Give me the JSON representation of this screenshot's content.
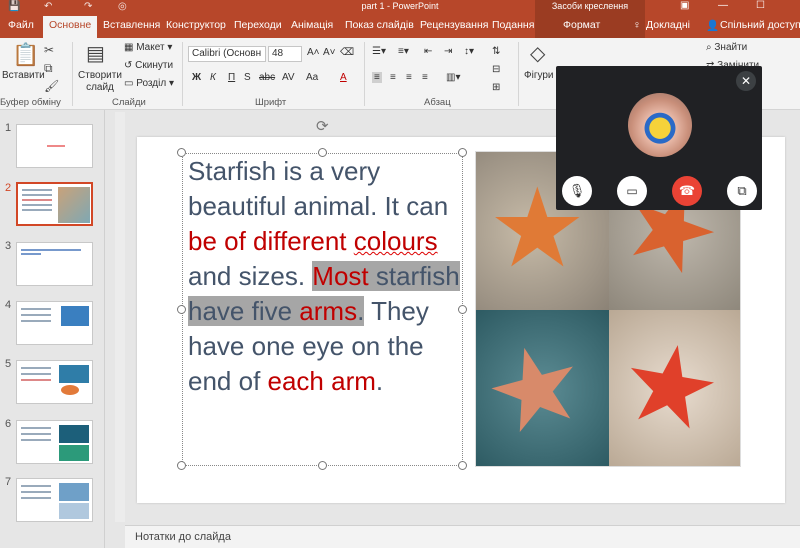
{
  "app": {
    "title": "part 1 - PowerPoint",
    "context_tool": "Засоби креслення"
  },
  "tabs": {
    "file": "Файл",
    "home": "Основне",
    "insert": "Вставлення",
    "design": "Конструктор",
    "transitions": "Переходи",
    "animations": "Анімація",
    "slideshow": "Показ слайдів",
    "review": "Рецензування",
    "view": "Подання",
    "format": "Формат",
    "tellme": "Докладні",
    "share": "Спільний доступ"
  },
  "ribbon": {
    "paste": "Вставити",
    "clipboard_group": "Буфер обміну",
    "new_slide": "Створити слайд",
    "layout": "Макет",
    "reset": "Скинути",
    "section": "Розділ",
    "slides_group": "Слайди",
    "font_name": "Calibri (Основн",
    "font_size": "48",
    "font_group": "Шрифт",
    "bold": "Ж",
    "italic": "К",
    "underline": "П",
    "shadow": "S",
    "strike": "abc",
    "spacing": "AV",
    "case": "Aa",
    "font_color": "A",
    "paragraph_group": "Абзац",
    "shapes": "Фігури",
    "find": "Знайти",
    "replace": "Замінити"
  },
  "slides_pane": {
    "numbers": [
      "1",
      "2",
      "3",
      "4",
      "5",
      "6",
      "7"
    ]
  },
  "slide": {
    "text_segments": [
      {
        "t": "Starfish is a very beautiful animal. It can ",
        "c": "n"
      },
      {
        "t": "be of different",
        "c": "r"
      },
      {
        "t": " ",
        "c": "n"
      },
      {
        "t": "colours",
        "c": "rs"
      },
      {
        "t": " and sizes. ",
        "c": "n"
      },
      {
        "t": "Most",
        "c": "rh"
      },
      {
        "t": " starfish have five ",
        "c": "h"
      },
      {
        "t": "arms",
        "c": "rh"
      },
      {
        "t": ".",
        "c": "h"
      },
      {
        "t": " They have one eye on the end of ",
        "c": "n"
      },
      {
        "t": "each arm",
        "c": "r"
      },
      {
        "t": ".",
        "c": "n"
      }
    ]
  },
  "notes": {
    "label": "Нотатки до слайда"
  },
  "call": {
    "close": "✕"
  },
  "colors": {
    "accent": "#b7472a",
    "text": "#44546a",
    "red": "#c00000",
    "highlight": "#a6a6a6",
    "call_bg": "#202124",
    "hangup": "#ea4335"
  }
}
